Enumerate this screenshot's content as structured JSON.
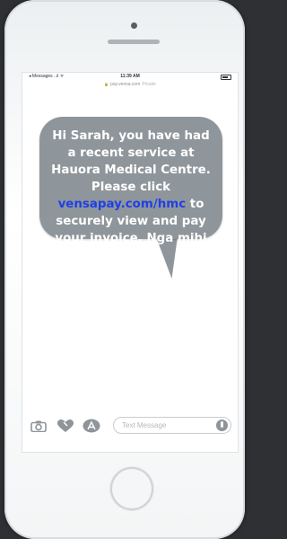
{
  "status_bar": {
    "carrier": "◂ Messages ..ıl ᯤ",
    "time": "11:39 AM"
  },
  "url_bar": {
    "domain": "pay.vensa.com",
    "mode": "Private"
  },
  "message": {
    "text_before_link": "Hi Sarah, you have had a recent service at Hauora Medical Centre. Please click ",
    "link": "vensapay.com/hmc",
    "text_after_link": " to securely view and pay your invoice. Nga mihi",
    "bubble_color": "#8f969b",
    "link_color": "#1f3fe6"
  },
  "composer": {
    "placeholder": "Text Message",
    "icons": [
      "camera-icon",
      "heart-icon",
      "appstore-icon",
      "microphone-icon"
    ]
  }
}
